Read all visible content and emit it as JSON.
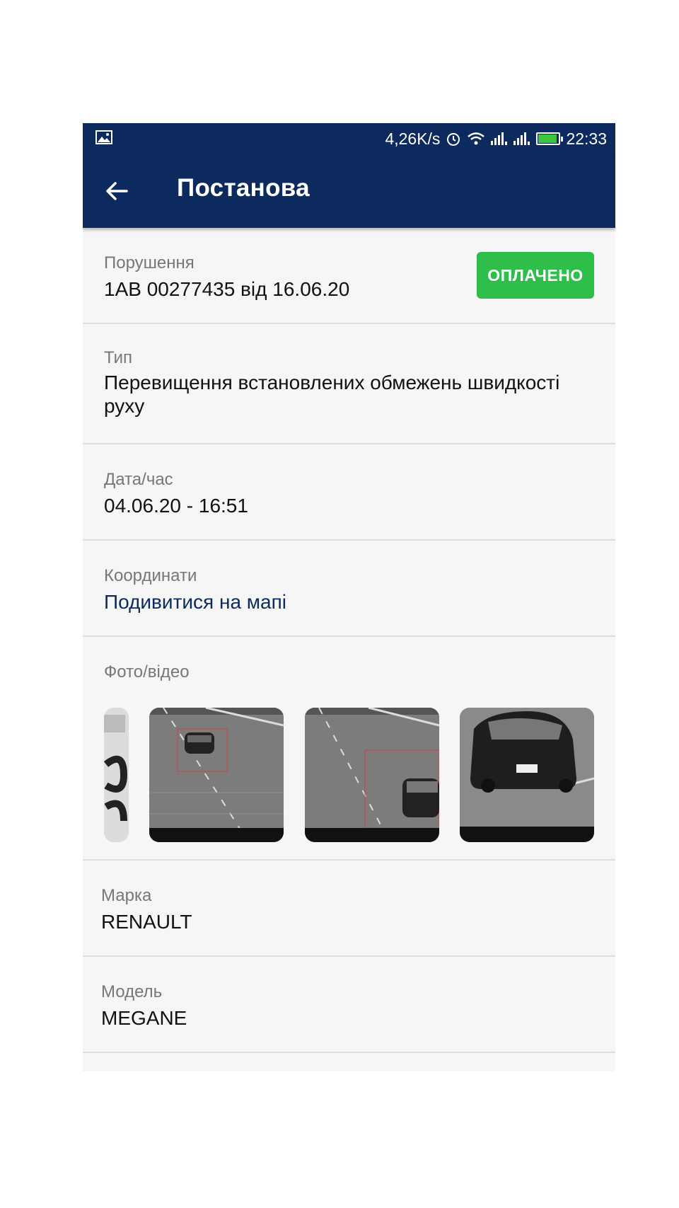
{
  "status_bar": {
    "speed": "4,26K/s",
    "time": "22:33",
    "icons": [
      "image-icon",
      "alarm-icon",
      "wifi-icon",
      "signal-icon",
      "signal-icon",
      "battery-icon"
    ]
  },
  "app_bar": {
    "title": "Постанова",
    "back_icon": "back-arrow-icon"
  },
  "violation": {
    "label": "Порушення",
    "value": "1AB 00277435 від 16.06.20",
    "status": "ОПЛАЧЕНО",
    "status_color": "#2fbe4a"
  },
  "type": {
    "label": "Тип",
    "value": "Перевищення встановлених обмежень швидкості руху"
  },
  "datetime": {
    "label": "Дата/час",
    "value": "04.06.20 - 16:51"
  },
  "coordinates": {
    "label": "Координати",
    "link": "Подивитися на мапі"
  },
  "media": {
    "label": "Фото/відео",
    "thumbnails": [
      "plate-closeup",
      "road-car-distant",
      "road-car-near",
      "car-front-closeup"
    ]
  },
  "brand": {
    "label": "Марка",
    "value": "RENAULT"
  },
  "model": {
    "label": "Модель",
    "value": "MEGANE"
  },
  "colors": {
    "primary": "#0c2a5e",
    "paid": "#2fbe4a"
  }
}
